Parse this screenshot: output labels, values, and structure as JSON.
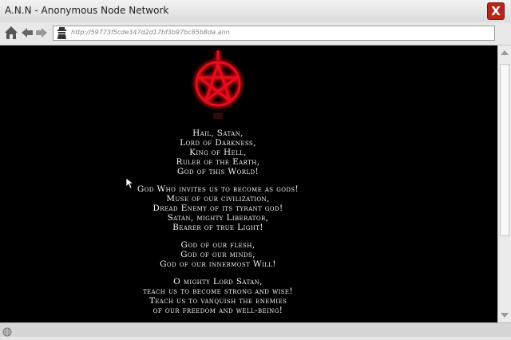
{
  "window": {
    "title": "A.N.N - Anonymous Node Network",
    "close_label": "X"
  },
  "nav": {
    "home_icon": "home-icon",
    "back_icon": "back-arrow-icon",
    "forward_icon": "forward-arrow-icon",
    "site_icon": "spy-agent-icon",
    "url": "http://59773f5cde347d2d17bf3b97bc85b8da.ann"
  },
  "colors": {
    "accent_red": "#e8101a",
    "close_button": "#b8261b",
    "page_background": "#000000"
  },
  "content": {
    "stanzas": [
      [
        "Hail, Satan,",
        "Lord of Darkness,",
        "King of Hell,",
        "Ruler of the Earth,",
        "God of this World!"
      ],
      [
        "God Who invites us to become as gods!",
        "Muse of our civilization,",
        "Dread Enemy of its tyrant god!",
        "Satan, mighty Liberator,",
        "Bearer of true Light!"
      ],
      [
        "God of our flesh,",
        "God of our minds,",
        "God of our innermost Will!"
      ],
      [
        "O mighty Lord Satan,",
        "teach us to become strong and wise!",
        "Teach us to vanquish the enemies",
        "of our freedom and well-being!"
      ]
    ]
  },
  "status": {
    "globe_icon": "globe-icon"
  }
}
